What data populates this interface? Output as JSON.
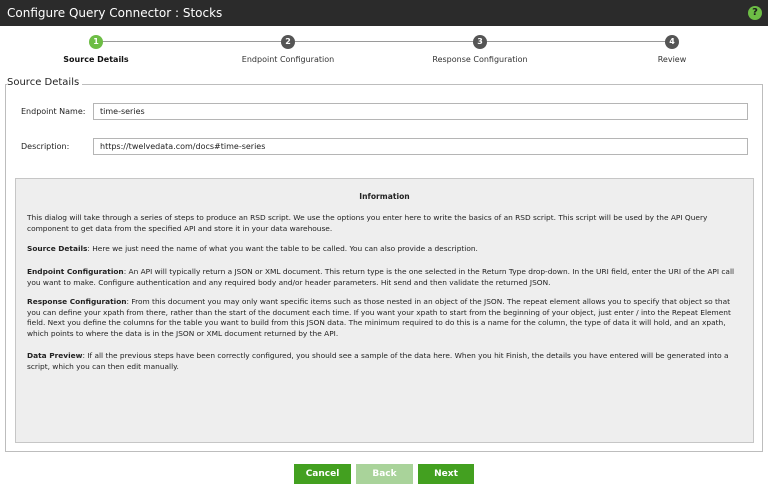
{
  "window": {
    "title": "Configure Query Connector : Stocks",
    "help_icon": "question-circle-icon",
    "help_glyph": "?"
  },
  "stepper": {
    "steps": [
      {
        "number": "1",
        "label": "Source Details",
        "state": "active"
      },
      {
        "number": "2",
        "label": "Endpoint Configuration",
        "state": "pending"
      },
      {
        "number": "3",
        "label": "Response Configuration",
        "state": "pending"
      },
      {
        "number": "4",
        "label": "Review",
        "state": "pending"
      }
    ]
  },
  "source_details": {
    "legend": "Source Details",
    "endpoint_name_label": "Endpoint Name:",
    "endpoint_name_value": "time-series",
    "description_label": "Description:",
    "description_value": "https://twelvedata.com/docs#time-series"
  },
  "information": {
    "title": "Information",
    "intro": "This dialog will take through a series of steps to produce an RSD script. We use the options you enter here to write the basics of an RSD script. This script will be used by the API Query component to get data from the specified API and store it in your data warehouse.",
    "sections": [
      {
        "heading": "Source Details",
        "text": ": Here we just need the name of what you want the table to be called. You can also provide a description."
      },
      {
        "heading": "Endpoint Configuration",
        "text": ": An API will typically return a JSON or XML document. This return type is the one selected in the Return Type drop-down. In the URI field, enter the URI of the API call you want to make. Configure authentication and any required body and/or header parameters. Hit send and then validate the returned JSON."
      },
      {
        "heading": "Response Configuration",
        "text": ": From this document you may only want specific items such as those nested in an object of the JSON. The repeat element allows you to specify that object so that you can define your xpath from there, rather than the start of the document each time. If you want your xpath to start from the beginning of your object, just enter / into the Repeat Element field. Next you define the columns for the table you want to build from this JSON data. The minimum required to do this is a name for the column, the type of data it will hold, and an xpath, which points to where the data is in the JSON or XML document returned by the API."
      },
      {
        "heading": "Data Preview",
        "text": ": If all the previous steps have been correctly configured, you should see a sample of the data here. When you hit Finish, the details you have entered will be generated into a script, which you can then edit manually."
      }
    ]
  },
  "buttons": {
    "cancel": "Cancel",
    "back": "Back",
    "next": "Next"
  },
  "colors": {
    "accent": "#43a020",
    "disabled_button": "#a9d39a",
    "titlebar": "#2b2b2b",
    "active_step": "#6dbd45",
    "pending_step": "#555555"
  }
}
